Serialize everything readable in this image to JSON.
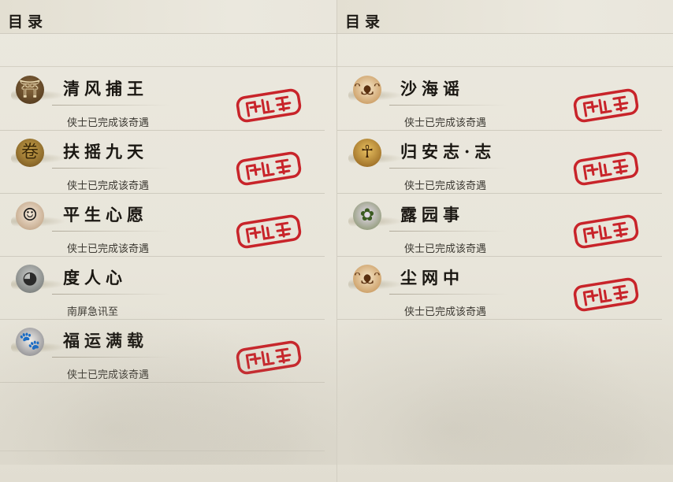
{
  "left_panel": {
    "header": "目录",
    "entries": [
      {
        "title": "清风捕王",
        "status": "侠士已完成该奇遇",
        "icon": "bamboo-hat-icon",
        "completed": true
      },
      {
        "title": "扶摇九天",
        "status": "侠士已完成该奇遇",
        "icon": "golden-scroll-icon",
        "completed": true
      },
      {
        "title": "平生心愿",
        "status": "侠士已完成该奇遇",
        "icon": "scholar-doll-icon",
        "completed": true
      },
      {
        "title": "度人心",
        "status": "南屏急讯至",
        "icon": "stone-mask-icon",
        "completed": false
      },
      {
        "title": "福运满载",
        "status": "侠士已完成该奇遇",
        "icon": "husky-dog-icon",
        "completed": true
      }
    ]
  },
  "right_panel": {
    "header": "目录",
    "entries": [
      {
        "title": "沙海谣",
        "status": "侠士已完成该奇遇",
        "icon": "fox-cat-icon",
        "completed": true
      },
      {
        "title": "归安志·志",
        "status": "侠士已完成该奇遇",
        "icon": "golden-figure-icon",
        "completed": true
      },
      {
        "title": "露园事",
        "status": "侠士已完成该奇遇",
        "icon": "flower-fairy-icon",
        "completed": true
      },
      {
        "title": "尘网中",
        "status": "侠士已完成该奇遇",
        "icon": "fox-cat-icon",
        "completed": true
      }
    ]
  },
  "colors": {
    "stamp_red": "#c8242a",
    "title_ink": "#1a1712",
    "status_text": "#3d3a33"
  }
}
